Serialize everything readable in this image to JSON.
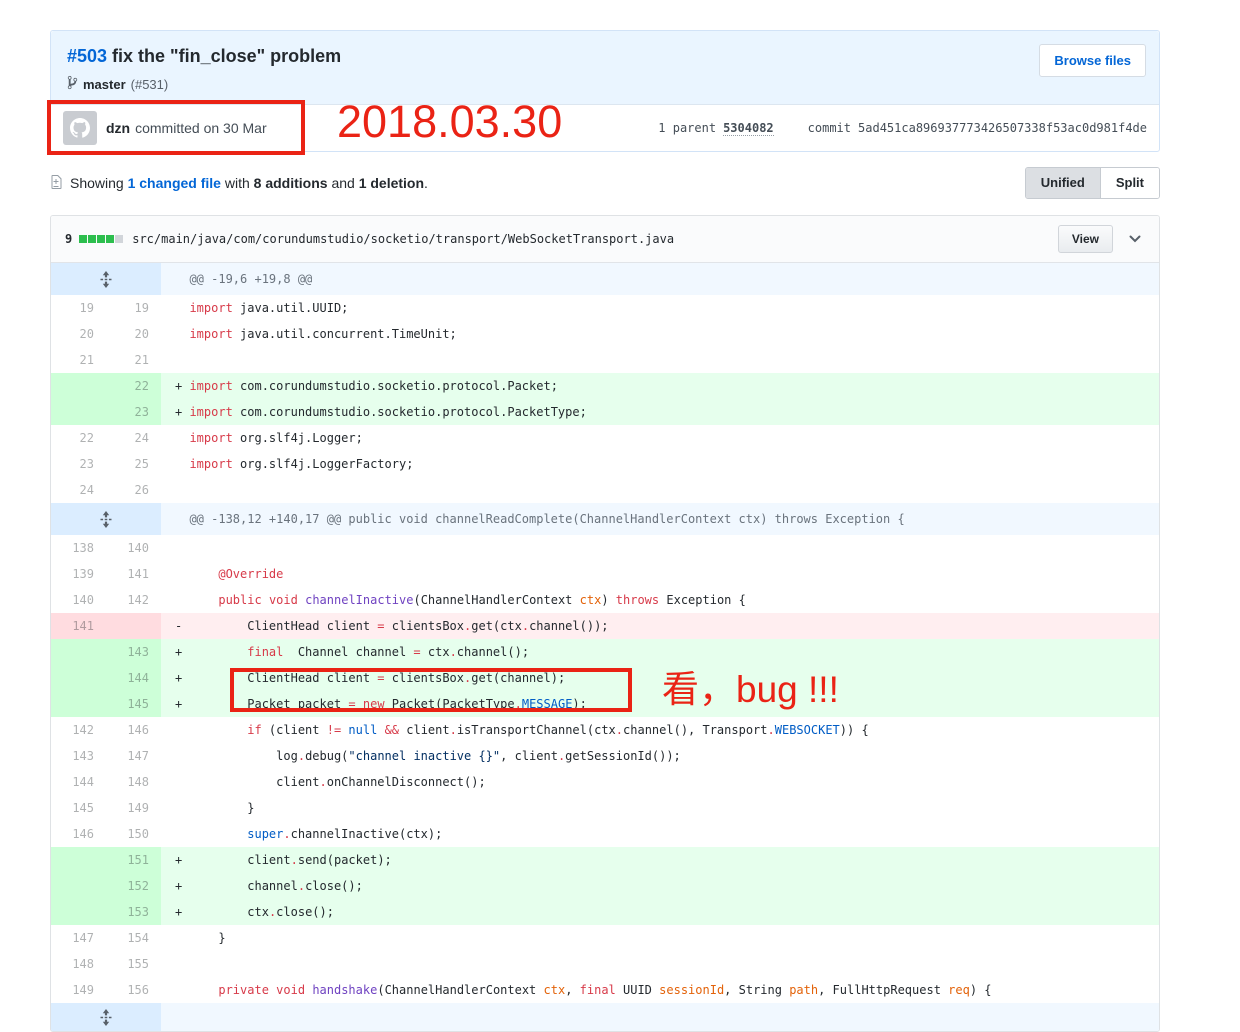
{
  "commit": {
    "title_number": "#503",
    "title_text": " fix the \"fin_close\" problem",
    "browse_files_label": "Browse files",
    "branch": "master",
    "pr_ref": "(#531)",
    "author": "dzn",
    "action": "committed on 30 Mar",
    "parent_label": "1 parent",
    "parent_sha": "5304082",
    "commit_label": "commit",
    "commit_sha": "5ad451ca896937773426507338f53ac0d981f4de"
  },
  "summary": {
    "prefix": "Showing",
    "changed_link": "1 changed file",
    "with": "with",
    "additions": "8 additions",
    "and": "and",
    "deletions": "1 deletion",
    "period": ".",
    "unified_label": "Unified",
    "split_label": "Split"
  },
  "file": {
    "changes_count": "9",
    "blocks": [
      "add",
      "add",
      "add",
      "add",
      "neutral"
    ],
    "path": "src/main/java/com/corundumstudio/socketio/transport/WebSocketTransport.java",
    "view_label": "View"
  },
  "annotations": {
    "date": "2018.03.30",
    "bug": "看，bug !!!",
    "color": "#ea2315"
  },
  "diff": {
    "rows": [
      {
        "type": "hunk",
        "text": "@@ -19,6 +19,8 @@"
      },
      {
        "type": "ctx",
        "old": "19",
        "new": "19",
        "code": [
          [
            "k",
            "import"
          ],
          [
            "p",
            " java.util.UUID;"
          ]
        ]
      },
      {
        "type": "ctx",
        "old": "20",
        "new": "20",
        "code": [
          [
            "k",
            "import"
          ],
          [
            "p",
            " java.util.concurrent.TimeUnit;"
          ]
        ]
      },
      {
        "type": "ctx",
        "old": "21",
        "new": "21",
        "code": []
      },
      {
        "type": "add",
        "old": "",
        "new": "22",
        "code": [
          [
            "k",
            "import"
          ],
          [
            "p",
            " com.corundumstudio.socketio.protocol.Packet;"
          ]
        ]
      },
      {
        "type": "add",
        "old": "",
        "new": "23",
        "code": [
          [
            "k",
            "import"
          ],
          [
            "p",
            " com.corundumstudio.socketio.protocol.PacketType;"
          ]
        ]
      },
      {
        "type": "ctx",
        "old": "22",
        "new": "24",
        "code": [
          [
            "k",
            "import"
          ],
          [
            "p",
            " org.slf4j.Logger;"
          ]
        ]
      },
      {
        "type": "ctx",
        "old": "23",
        "new": "25",
        "code": [
          [
            "k",
            "import"
          ],
          [
            "p",
            " org.slf4j.LoggerFactory;"
          ]
        ]
      },
      {
        "type": "ctx",
        "old": "24",
        "new": "26",
        "code": []
      },
      {
        "type": "hunk",
        "text": "@@ -138,12 +140,17 @@ public void channelReadComplete(ChannelHandlerContext ctx) throws Exception {"
      },
      {
        "type": "ctx",
        "old": "138",
        "new": "140",
        "code": []
      },
      {
        "type": "ctx",
        "old": "139",
        "new": "141",
        "code": [
          [
            "p",
            "    "
          ],
          [
            "k",
            "@Override"
          ]
        ]
      },
      {
        "type": "ctx",
        "old": "140",
        "new": "142",
        "code": [
          [
            "p",
            "    "
          ],
          [
            "k",
            "public"
          ],
          [
            "p",
            " "
          ],
          [
            "k",
            "void"
          ],
          [
            "p",
            " "
          ],
          [
            "f",
            "channelInactive"
          ],
          [
            "p",
            "(ChannelHandlerContext "
          ],
          [
            "v",
            "ctx"
          ],
          [
            "p",
            ") "
          ],
          [
            "k",
            "throws"
          ],
          [
            "p",
            " Exception {"
          ]
        ]
      },
      {
        "type": "del",
        "old": "141",
        "new": "",
        "code": [
          [
            "p",
            "        ClientHead client "
          ],
          [
            "k",
            "="
          ],
          [
            "p",
            " clientsBox"
          ],
          [
            "k",
            "."
          ],
          [
            "p",
            "get(ctx"
          ],
          [
            "k",
            "."
          ],
          [
            "p",
            "channel());"
          ]
        ]
      },
      {
        "type": "add",
        "old": "",
        "new": "143",
        "code": [
          [
            "p",
            "        "
          ],
          [
            "k",
            "final"
          ],
          [
            "p",
            "  Channel channel "
          ],
          [
            "k",
            "="
          ],
          [
            "p",
            " ctx"
          ],
          [
            "k",
            "."
          ],
          [
            "p",
            "channel();"
          ]
        ]
      },
      {
        "type": "add",
        "old": "",
        "new": "144",
        "code": [
          [
            "p",
            "        ClientHead client "
          ],
          [
            "k",
            "="
          ],
          [
            "p",
            " clientsBox"
          ],
          [
            "k",
            "."
          ],
          [
            "p",
            "get(channel);"
          ]
        ]
      },
      {
        "type": "add",
        "old": "",
        "new": "145",
        "code": [
          [
            "p",
            "        Packet packet "
          ],
          [
            "k",
            "="
          ],
          [
            "p",
            " "
          ],
          [
            "k",
            "new"
          ],
          [
            "p",
            " Packet(PacketType"
          ],
          [
            "k",
            "."
          ],
          [
            "c",
            "MESSAGE"
          ],
          [
            "p",
            ");"
          ]
        ]
      },
      {
        "type": "ctx",
        "old": "142",
        "new": "146",
        "code": [
          [
            "p",
            "        "
          ],
          [
            "k",
            "if"
          ],
          [
            "p",
            " (client "
          ],
          [
            "k",
            "!="
          ],
          [
            "p",
            " "
          ],
          [
            "c",
            "null"
          ],
          [
            "p",
            " "
          ],
          [
            "k",
            "&&"
          ],
          [
            "p",
            " client"
          ],
          [
            "k",
            "."
          ],
          [
            "p",
            "isTransportChannel(ctx"
          ],
          [
            "k",
            "."
          ],
          [
            "p",
            "channel(), Transport"
          ],
          [
            "k",
            "."
          ],
          [
            "c",
            "WEBSOCKET"
          ],
          [
            "p",
            ")) {"
          ]
        ]
      },
      {
        "type": "ctx",
        "old": "143",
        "new": "147",
        "code": [
          [
            "p",
            "            log"
          ],
          [
            "k",
            "."
          ],
          [
            "p",
            "debug("
          ],
          [
            "s",
            "\"channel inactive {}\""
          ],
          [
            "p",
            ", client"
          ],
          [
            "k",
            "."
          ],
          [
            "p",
            "getSessionId());"
          ]
        ]
      },
      {
        "type": "ctx",
        "old": "144",
        "new": "148",
        "code": [
          [
            "p",
            "            client"
          ],
          [
            "k",
            "."
          ],
          [
            "p",
            "onChannelDisconnect();"
          ]
        ]
      },
      {
        "type": "ctx",
        "old": "145",
        "new": "149",
        "code": [
          [
            "p",
            "        }"
          ]
        ]
      },
      {
        "type": "ctx",
        "old": "146",
        "new": "150",
        "code": [
          [
            "p",
            "        "
          ],
          [
            "c",
            "super"
          ],
          [
            "k",
            "."
          ],
          [
            "p",
            "channelInactive(ctx);"
          ]
        ]
      },
      {
        "type": "add",
        "old": "",
        "new": "151",
        "code": [
          [
            "p",
            "        client"
          ],
          [
            "k",
            "."
          ],
          [
            "p",
            "send(packet);"
          ]
        ]
      },
      {
        "type": "add",
        "old": "",
        "new": "152",
        "code": [
          [
            "p",
            "        channel"
          ],
          [
            "k",
            "."
          ],
          [
            "p",
            "close();"
          ]
        ]
      },
      {
        "type": "add",
        "old": "",
        "new": "153",
        "code": [
          [
            "p",
            "        ctx"
          ],
          [
            "k",
            "."
          ],
          [
            "p",
            "close();"
          ]
        ]
      },
      {
        "type": "ctx",
        "old": "147",
        "new": "154",
        "code": [
          [
            "p",
            "    }"
          ]
        ]
      },
      {
        "type": "ctx",
        "old": "148",
        "new": "155",
        "code": []
      },
      {
        "type": "ctx",
        "old": "149",
        "new": "156",
        "code": [
          [
            "p",
            "    "
          ],
          [
            "k",
            "private"
          ],
          [
            "p",
            " "
          ],
          [
            "k",
            "void"
          ],
          [
            "p",
            " "
          ],
          [
            "f",
            "handshake"
          ],
          [
            "p",
            "(ChannelHandlerContext "
          ],
          [
            "v",
            "ctx"
          ],
          [
            "p",
            ", "
          ],
          [
            "k",
            "final"
          ],
          [
            "p",
            " UUID "
          ],
          [
            "v",
            "sessionId"
          ],
          [
            "p",
            ", String "
          ],
          [
            "v",
            "path"
          ],
          [
            "p",
            ", FullHttpRequest "
          ],
          [
            "v",
            "req"
          ],
          [
            "p",
            ") {"
          ]
        ]
      },
      {
        "type": "expand"
      }
    ]
  }
}
